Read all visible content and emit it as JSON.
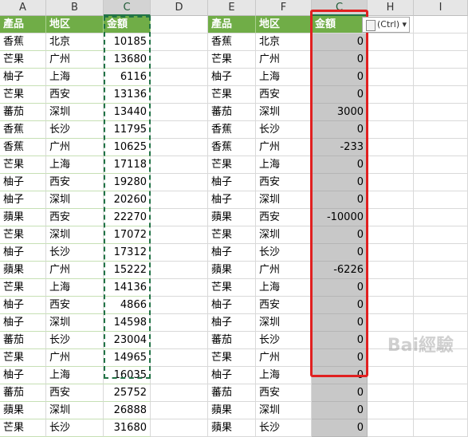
{
  "columns": [
    "A",
    "B",
    "C",
    "D",
    "E",
    "F",
    "C",
    "H",
    "I"
  ],
  "left_table": {
    "headers": [
      "產品",
      "地区",
      "金額"
    ],
    "rows": [
      [
        "香蕉",
        "北京",
        "10185"
      ],
      [
        "芒果",
        "广州",
        "13680"
      ],
      [
        "柚子",
        "上海",
        "6116"
      ],
      [
        "芒果",
        "西安",
        "13136"
      ],
      [
        "蕃茄",
        "深圳",
        "13440"
      ],
      [
        "香蕉",
        "长沙",
        "11795"
      ],
      [
        "香蕉",
        "广州",
        "10625"
      ],
      [
        "芒果",
        "上海",
        "17118"
      ],
      [
        "柚子",
        "西安",
        "19280"
      ],
      [
        "柚子",
        "深圳",
        "20260"
      ],
      [
        "蘋果",
        "西安",
        "22270"
      ],
      [
        "芒果",
        "深圳",
        "17072"
      ],
      [
        "柚子",
        "长沙",
        "17312"
      ],
      [
        "蘋果",
        "广州",
        "15222"
      ],
      [
        "芒果",
        "上海",
        "14136"
      ],
      [
        "柚子",
        "西安",
        "4866"
      ],
      [
        "柚子",
        "深圳",
        "14598"
      ],
      [
        "蕃茄",
        "长沙",
        "23004"
      ],
      [
        "芒果",
        "广州",
        "14965"
      ],
      [
        "柚子",
        "上海",
        "16035"
      ],
      [
        "蕃茄",
        "西安",
        "25752"
      ],
      [
        "蘋果",
        "深圳",
        "26888"
      ],
      [
        "芒果",
        "长沙",
        "31680"
      ]
    ]
  },
  "right_table": {
    "headers": [
      "產品",
      "地区",
      "金額"
    ],
    "rows": [
      [
        "香蕉",
        "北京",
        "0"
      ],
      [
        "芒果",
        "广州",
        "0"
      ],
      [
        "柚子",
        "上海",
        "0"
      ],
      [
        "芒果",
        "西安",
        "0"
      ],
      [
        "蕃茄",
        "深圳",
        "3000"
      ],
      [
        "香蕉",
        "长沙",
        "0"
      ],
      [
        "香蕉",
        "广州",
        "-233"
      ],
      [
        "芒果",
        "上海",
        "0"
      ],
      [
        "柚子",
        "西安",
        "0"
      ],
      [
        "柚子",
        "深圳",
        "0"
      ],
      [
        "蘋果",
        "西安",
        "-10000"
      ],
      [
        "芒果",
        "深圳",
        "0"
      ],
      [
        "柚子",
        "长沙",
        "0"
      ],
      [
        "蘋果",
        "广州",
        "-6226"
      ],
      [
        "芒果",
        "上海",
        "0"
      ],
      [
        "柚子",
        "西安",
        "0"
      ],
      [
        "柚子",
        "深圳",
        "0"
      ],
      [
        "蕃茄",
        "长沙",
        "0"
      ],
      [
        "芒果",
        "广州",
        "0"
      ],
      [
        "柚子",
        "上海",
        "0"
      ],
      [
        "蕃茄",
        "西安",
        "0"
      ],
      [
        "蘋果",
        "深圳",
        "0"
      ],
      [
        "蘋果",
        "长沙",
        "0"
      ]
    ]
  },
  "paste_options": {
    "label": "(Ctrl)",
    "icon": "clipboard-icon"
  },
  "watermark": "Bai經驗"
}
